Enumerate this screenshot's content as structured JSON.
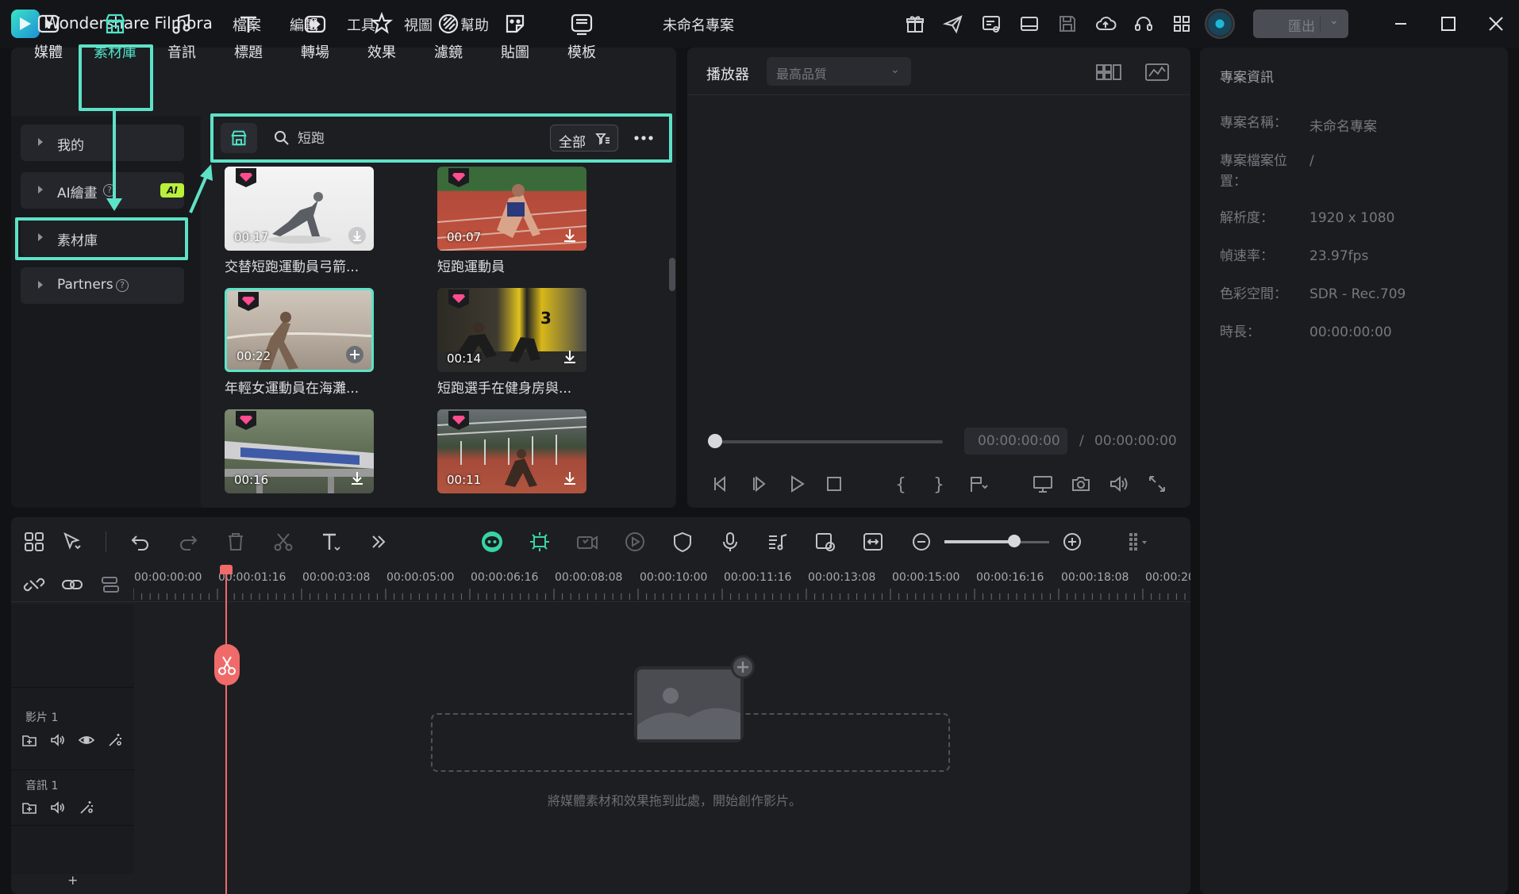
{
  "app": {
    "name": "Wondershare Filmora",
    "project_title": "未命名專案"
  },
  "menu": [
    "檔案",
    "編輯",
    "工具",
    "視圖",
    "幫助"
  ],
  "export": {
    "label": "匯出"
  },
  "media_tabs": [
    {
      "label": "媒體",
      "icon": "media-icon"
    },
    {
      "label": "素材庫",
      "icon": "stock-library-icon",
      "active": true
    },
    {
      "label": "音訊",
      "icon": "music-note-icon"
    },
    {
      "label": "標題",
      "icon": "title-t-icon"
    },
    {
      "label": "轉場",
      "icon": "transition-icon"
    },
    {
      "label": "效果",
      "icon": "effects-star-icon"
    },
    {
      "label": "濾鏡",
      "icon": "filter-icon"
    },
    {
      "label": "貼圖",
      "icon": "sticker-icon"
    },
    {
      "label": "模板",
      "icon": "template-icon"
    }
  ],
  "sidebar": [
    {
      "label": "我的"
    },
    {
      "label": "AI繪畫",
      "badge": "AI"
    },
    {
      "label": "素材庫",
      "selected": true
    },
    {
      "label": "Partners"
    }
  ],
  "search": {
    "value": "短跑",
    "filter_label": "全部"
  },
  "thumbnails": [
    {
      "duration": "00:17",
      "caption": "交替短跑運動員弓箭..."
    },
    {
      "duration": "00:07",
      "caption": "短跑運動員"
    },
    {
      "duration": "00:22",
      "caption": "年輕女運動員在海灘..."
    },
    {
      "duration": "00:14",
      "caption": "短跑選手在健身房與..."
    },
    {
      "duration": "00:16",
      "caption": ""
    },
    {
      "duration": "00:11",
      "caption": ""
    }
  ],
  "player": {
    "label": "播放器",
    "quality": "最高品質",
    "current_time": "00:00:00:00",
    "separator": "/",
    "total_time": "00:00:00:00"
  },
  "project_info": {
    "title": "專案資訊",
    "rows": [
      {
        "label": "專案名稱：",
        "value": "未命名專案"
      },
      {
        "label": "專案檔案位置：",
        "value": "/"
      },
      {
        "label": "解析度：",
        "value": "1920 x 1080"
      },
      {
        "label": "幀速率：",
        "value": "23.97fps"
      },
      {
        "label": "色彩空間：",
        "value": "SDR - Rec.709"
      },
      {
        "label": "時長：",
        "value": "00:00:00:00"
      }
    ]
  },
  "timeline": {
    "ruler": [
      "00:00:00:00",
      "00:00:01:16",
      "00:00:03:08",
      "00:00:05:00",
      "00:00:06:16",
      "00:00:08:08",
      "00:00:10:00",
      "00:00:11:16",
      "00:00:13:08",
      "00:00:15:00",
      "00:00:16:16",
      "00:00:18:08",
      "00:00:20"
    ],
    "tracks": [
      {
        "label": "影片 1"
      },
      {
        "label": "音訊 1"
      }
    ],
    "drop_hint": "將媒體素材和效果拖到此處，開始創作影片。",
    "add_track": "+"
  },
  "colors": {
    "accent": "#5ee2c7",
    "playhead": "#f06a6a",
    "ai_badge": "#b8f03a",
    "gem": "#ff4d8d"
  }
}
